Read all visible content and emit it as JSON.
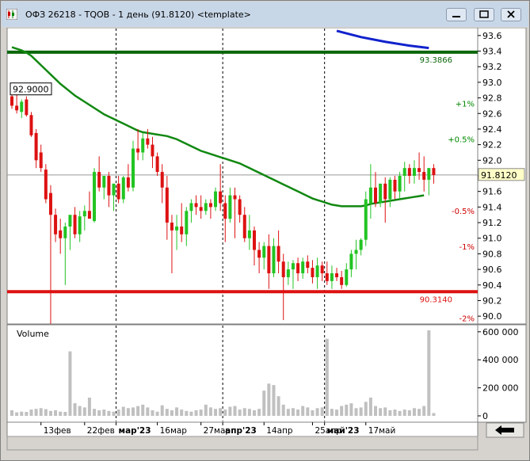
{
  "window": {
    "title": "ОФЗ 26218 - TQOB - 1 день (91.8120) <template>"
  },
  "price_panel": {
    "y_ticks": [
      "93.6",
      "93.4",
      "93.2",
      "93.0",
      "92.8",
      "92.6",
      "92.4",
      "92.2",
      "92.0",
      "91.8",
      "91.6",
      "91.4",
      "91.2",
      "91.0",
      "90.8",
      "90.6",
      "90.4",
      "90.2",
      "90.0"
    ],
    "last_price_label": "91.8120",
    "marker_label": "92.9000",
    "upper_line_label": "93.3866",
    "lower_line_label": "90.3140",
    "pct_labels": [
      "+1%",
      "+0.5%",
      "-0.5%",
      "-1%",
      "-2%"
    ],
    "colors": {
      "up": "#22c422",
      "down": "#dd1111",
      "ma": "#118811",
      "blue": "#1122cc",
      "upper": "#0a660a",
      "lower": "#dd1111"
    }
  },
  "volume_panel": {
    "title": "Volume",
    "y_ticks": [
      "600 000",
      "400 000",
      "200 000",
      "0"
    ]
  },
  "x_axis": {
    "labels": [
      "13фев",
      "22фев",
      "мар'23",
      "16мар",
      "27мар",
      "апр'23",
      "14апр",
      "25апр",
      "май'23",
      "17май"
    ]
  },
  "chart_data": {
    "type": "candlestick",
    "y_range": [
      89.9,
      93.7
    ],
    "volume_range": [
      0,
      650000
    ],
    "upper_level": 93.3866,
    "lower_level": 90.314,
    "last_price": 91.812,
    "candles": [
      [
        92.82,
        92.88,
        92.66,
        92.7,
        40000
      ],
      [
        92.7,
        92.84,
        92.6,
        92.64,
        25000
      ],
      [
        92.62,
        92.78,
        92.54,
        92.75,
        30000
      ],
      [
        92.78,
        92.82,
        92.56,
        92.58,
        28000
      ],
      [
        92.58,
        92.62,
        92.3,
        92.32,
        45000
      ],
      [
        92.35,
        92.4,
        91.9,
        92.0,
        50000
      ],
      [
        92.1,
        92.2,
        91.85,
        91.9,
        55000
      ],
      [
        91.88,
        91.95,
        91.45,
        91.5,
        48000
      ],
      [
        91.58,
        91.68,
        89.9,
        91.3,
        35000
      ],
      [
        91.3,
        91.38,
        90.95,
        91.05,
        40000
      ],
      [
        91.1,
        91.25,
        90.8,
        91.0,
        30000
      ],
      [
        91.0,
        91.2,
        90.4,
        91.15,
        28000
      ],
      [
        91.15,
        91.25,
        90.85,
        91.3,
        460000
      ],
      [
        91.3,
        91.4,
        91.0,
        91.05,
        90000
      ],
      [
        91.05,
        91.35,
        90.95,
        91.28,
        70000
      ],
      [
        91.28,
        91.42,
        91.1,
        91.35,
        60000
      ],
      [
        91.35,
        91.6,
        91.25,
        91.25,
        130000
      ],
      [
        91.22,
        91.9,
        91.2,
        91.85,
        50000
      ],
      [
        91.85,
        92.05,
        91.6,
        91.65,
        40000
      ],
      [
        91.65,
        91.8,
        91.5,
        91.8,
        45000
      ],
      [
        91.8,
        91.85,
        91.4,
        91.55,
        35000
      ],
      [
        91.55,
        91.7,
        91.35,
        91.7,
        30000
      ],
      [
        91.7,
        91.8,
        91.45,
        91.5,
        45000
      ],
      [
        91.5,
        91.8,
        91.45,
        91.78,
        65000
      ],
      [
        91.78,
        91.95,
        91.6,
        91.65,
        55000
      ],
      [
        91.65,
        92.25,
        91.6,
        92.15,
        60000
      ],
      [
        92.15,
        92.4,
        92.0,
        92.1,
        70000
      ],
      [
        92.1,
        92.35,
        92.0,
        92.28,
        80000
      ],
      [
        92.28,
        92.4,
        92.15,
        92.2,
        60000
      ],
      [
        92.2,
        92.3,
        91.9,
        92.05,
        40000
      ],
      [
        92.05,
        92.1,
        91.8,
        91.85,
        30000
      ],
      [
        91.85,
        91.95,
        91.45,
        91.65,
        75000
      ],
      [
        91.65,
        91.8,
        90.98,
        91.2,
        50000
      ],
      [
        91.2,
        91.3,
        90.55,
        91.1,
        40000
      ],
      [
        91.1,
        91.3,
        90.85,
        91.15,
        60000
      ],
      [
        91.15,
        91.45,
        90.95,
        91.05,
        45000
      ],
      [
        91.05,
        91.4,
        90.9,
        91.35,
        35000
      ],
      [
        91.35,
        91.5,
        91.2,
        91.45,
        30000
      ],
      [
        91.45,
        91.55,
        91.3,
        91.4,
        40000
      ],
      [
        91.4,
        91.55,
        91.25,
        91.35,
        45000
      ],
      [
        91.35,
        91.5,
        91.3,
        91.45,
        80000
      ],
      [
        91.45,
        91.5,
        91.25,
        91.4,
        60000
      ],
      [
        91.4,
        91.65,
        91.35,
        91.6,
        50000
      ],
      [
        91.6,
        91.95,
        91.35,
        91.45,
        55000
      ],
      [
        91.45,
        91.55,
        90.95,
        91.25,
        45000
      ],
      [
        91.25,
        91.65,
        91.2,
        91.55,
        65000
      ],
      [
        91.55,
        91.65,
        91.0,
        91.5,
        70000
      ],
      [
        91.5,
        91.55,
        91.2,
        91.3,
        45000
      ],
      [
        91.3,
        91.4,
        90.95,
        91.0,
        55000
      ],
      [
        91.0,
        91.3,
        90.85,
        91.1,
        50000
      ],
      [
        91.1,
        91.15,
        90.65,
        90.85,
        40000
      ],
      [
        90.85,
        90.95,
        90.55,
        90.75,
        50000
      ],
      [
        90.75,
        90.95,
        90.6,
        90.9,
        180000
      ],
      [
        90.9,
        91.05,
        90.35,
        90.55,
        230000
      ],
      [
        90.55,
        91.0,
        90.5,
        90.9,
        220000
      ],
      [
        90.9,
        91.1,
        90.55,
        90.7,
        140000
      ],
      [
        90.7,
        90.8,
        89.95,
        90.5,
        80000
      ],
      [
        90.5,
        90.7,
        90.4,
        90.6,
        50000
      ],
      [
        90.6,
        90.72,
        90.35,
        90.68,
        55000
      ],
      [
        90.68,
        90.75,
        90.45,
        90.55,
        45000
      ],
      [
        90.55,
        90.75,
        90.48,
        90.7,
        70000
      ],
      [
        90.7,
        90.78,
        90.55,
        90.62,
        60000
      ],
      [
        90.62,
        90.72,
        90.42,
        90.5,
        40000
      ],
      [
        90.5,
        90.75,
        90.35,
        90.65,
        55000
      ],
      [
        90.65,
        90.7,
        90.45,
        90.55,
        60000
      ],
      [
        90.55,
        90.7,
        90.4,
        90.45,
        550000
      ],
      [
        90.45,
        90.65,
        90.35,
        90.55,
        50000
      ],
      [
        90.55,
        90.62,
        90.45,
        90.5,
        45000
      ],
      [
        90.5,
        90.58,
        90.35,
        90.4,
        70000
      ],
      [
        90.4,
        90.68,
        90.38,
        90.6,
        80000
      ],
      [
        90.6,
        90.85,
        90.5,
        90.8,
        90000
      ],
      [
        90.8,
        90.98,
        90.6,
        90.85,
        55000
      ],
      [
        90.85,
        91.0,
        90.78,
        90.98,
        60000
      ],
      [
        90.98,
        91.6,
        90.9,
        91.5,
        100000
      ],
      [
        91.45,
        91.95,
        91.25,
        91.65,
        130000
      ],
      [
        91.65,
        91.85,
        91.4,
        91.45,
        70000
      ],
      [
        91.45,
        91.7,
        91.4,
        91.7,
        55000
      ],
      [
        91.7,
        91.78,
        91.2,
        91.5,
        60000
      ],
      [
        91.5,
        91.78,
        91.4,
        91.75,
        40000
      ],
      [
        91.75,
        91.8,
        91.5,
        91.6,
        45000
      ],
      [
        91.6,
        91.85,
        91.5,
        91.8,
        35000
      ],
      [
        91.8,
        91.98,
        91.6,
        91.9,
        45000
      ],
      [
        91.9,
        91.95,
        91.7,
        91.8,
        40000
      ],
      [
        91.8,
        92.0,
        91.7,
        91.9,
        55000
      ],
      [
        91.9,
        92.1,
        91.75,
        91.85,
        50000
      ],
      [
        91.85,
        92.05,
        91.6,
        91.75,
        70000
      ],
      [
        91.75,
        91.9,
        91.55,
        91.9,
        610000
      ],
      [
        91.9,
        91.95,
        91.7,
        91.81,
        20000
      ]
    ],
    "ma": [
      93.45,
      93.43,
      93.41,
      93.38,
      93.34,
      93.28,
      93.22,
      93.16,
      93.1,
      93.04,
      92.98,
      92.93,
      92.88,
      92.83,
      92.79,
      92.75,
      92.71,
      92.67,
      92.63,
      92.59,
      92.56,
      92.53,
      92.5,
      92.47,
      92.44,
      92.41,
      92.38,
      92.36,
      92.35,
      92.34,
      92.33,
      92.32,
      92.31,
      92.29,
      92.27,
      92.24,
      92.21,
      92.18,
      92.15,
      92.12,
      92.1,
      92.08,
      92.06,
      92.04,
      92.02,
      92.0,
      91.98,
      91.96,
      91.93,
      91.9,
      91.87,
      91.84,
      91.81,
      91.78,
      91.75,
      91.72,
      91.69,
      91.66,
      91.63,
      91.6,
      91.57,
      91.54,
      91.51,
      91.49,
      91.47,
      91.45,
      91.43,
      91.42,
      91.41,
      91.41,
      91.41,
      91.41,
      91.41,
      91.42,
      91.44,
      91.45,
      91.46,
      91.47,
      91.48,
      91.49,
      91.5,
      91.51,
      91.52,
      91.53,
      91.54,
      91.55
    ],
    "blue_line": [
      [
        67,
        93.66
      ],
      [
        72,
        93.58
      ],
      [
        77,
        93.52
      ],
      [
        82,
        93.47
      ],
      [
        86,
        93.44
      ]
    ],
    "separator_candle_indexes": [
      21,
      43,
      64
    ]
  }
}
